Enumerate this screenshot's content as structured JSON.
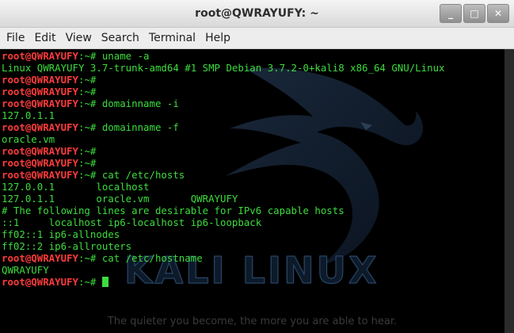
{
  "window": {
    "title": "root@QWRAYUFY: ~",
    "buttons": {
      "minimize": "_",
      "maximize": "□",
      "close": "✕"
    }
  },
  "menu": [
    "File",
    "Edit",
    "View",
    "Search",
    "Terminal",
    "Help"
  ],
  "background": {
    "logo_text": "KALI LINUX",
    "tagline": "The quieter you become, the more you are able to hear."
  },
  "prompt": {
    "user": "root@QWRAYUFY",
    "path": ":~#"
  },
  "lines": [
    {
      "kind": "prompt",
      "cmd": " uname -a"
    },
    {
      "kind": "out",
      "text": "Linux QWRAYUFY 3.7-trunk-amd64 #1 SMP Debian 3.7.2-0+kali8 x86_64 GNU/Linux"
    },
    {
      "kind": "prompt",
      "cmd": ""
    },
    {
      "kind": "prompt",
      "cmd": ""
    },
    {
      "kind": "prompt",
      "cmd": " domainname -i"
    },
    {
      "kind": "out",
      "text": "127.0.1.1"
    },
    {
      "kind": "prompt",
      "cmd": " domainname -f"
    },
    {
      "kind": "out",
      "text": "oracle.vm"
    },
    {
      "kind": "prompt",
      "cmd": ""
    },
    {
      "kind": "prompt",
      "cmd": ""
    },
    {
      "kind": "prompt",
      "cmd": " cat /etc/hosts"
    },
    {
      "kind": "out",
      "text": "127.0.0.1       localhost"
    },
    {
      "kind": "out",
      "text": "127.0.1.1       oracle.vm       QWRAYUFY"
    },
    {
      "kind": "out",
      "text": "# The following lines are desirable for IPv6 capable hosts"
    },
    {
      "kind": "out",
      "text": "::1     localhost ip6-localhost ip6-loopback"
    },
    {
      "kind": "out",
      "text": "ff02::1 ip6-allnodes"
    },
    {
      "kind": "out",
      "text": "ff02::2 ip6-allrouters"
    },
    {
      "kind": "prompt",
      "cmd": " cat /etc/hostname"
    },
    {
      "kind": "out",
      "text": "QWRAYUFY"
    },
    {
      "kind": "prompt",
      "cmd": " ",
      "cursor": true
    }
  ],
  "colors": {
    "prompt_user": "#ff3b3b",
    "text": "#3ddc3d",
    "terminal_bg": "#000000"
  }
}
